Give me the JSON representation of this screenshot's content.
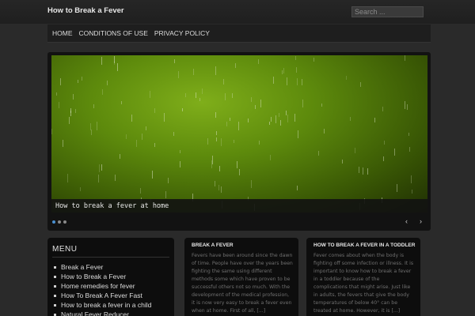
{
  "header": {
    "site_title": "How to Break a Fever",
    "search_placeholder": "Search ..."
  },
  "nav": {
    "items": [
      {
        "label": "HOME"
      },
      {
        "label": "CONDITIONS OF USE"
      },
      {
        "label": "PRIVACY POLICY"
      }
    ]
  },
  "slider": {
    "caption": "How to break a fever at home",
    "prev_icon": "‹",
    "next_icon": "›",
    "dot_count": 3,
    "active_dot": 0
  },
  "menu": {
    "title": "MENU",
    "items": [
      {
        "label": "Break a Fever"
      },
      {
        "label": "How to Break a Fever"
      },
      {
        "label": "Home remedies for fever"
      },
      {
        "label": "How To Break A Fever Fast"
      },
      {
        "label": "How to break a fever in a child"
      },
      {
        "label": "Natural Fever Reducer"
      }
    ]
  },
  "posts": [
    {
      "title": "BREAK A FEVER",
      "excerpt": "Fevers have been around since the dawn of time. People have over the years been fighting the same using different methods some which have proven to be successful others not so much. With the development of the medical profession, it is now very easy to break a fever even when at home. First of all, [...]"
    },
    {
      "title": "HOW TO BREAK A FEVER IN A TODDLER",
      "excerpt": "Fever comes about when the body is fighting off some infection or illness. It is important to know how to break a fever in a toddler because of the complications that might arise. Just like in adults, the fevers that give the body temperatures of below 40° can be treated at home. However, it is [...]"
    }
  ],
  "colors": {
    "background": "#2a2a2a",
    "panel": "#0d0d0d",
    "accent_dot": "#4a90d0",
    "slide_green": "#6a9a10"
  }
}
